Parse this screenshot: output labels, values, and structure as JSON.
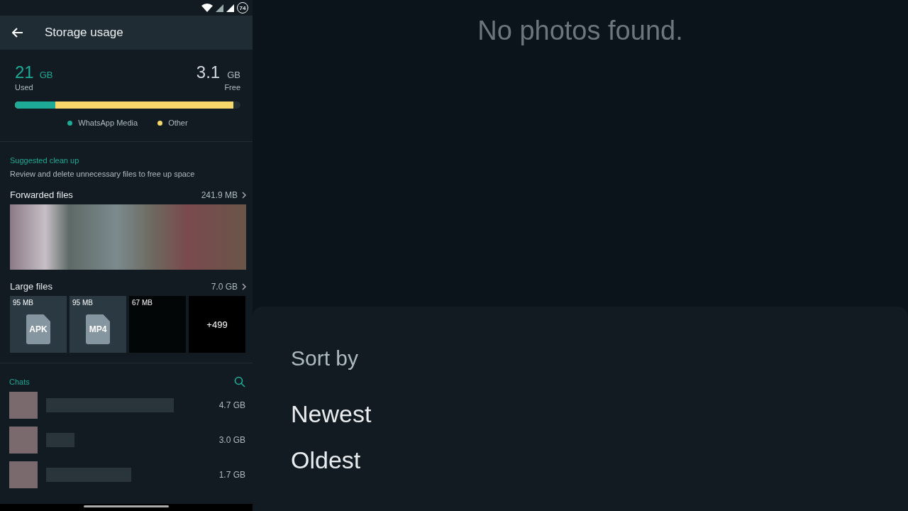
{
  "status_bar": {
    "battery": "74"
  },
  "app_bar": {
    "title": "Storage usage"
  },
  "storage": {
    "used_value": "21",
    "used_unit": "GB",
    "used_label": "Used",
    "free_value": "3.1",
    "free_unit": "GB",
    "free_label": "Free",
    "segments": [
      {
        "name": "WhatsApp Media",
        "color": "#1daa96",
        "level": 0.18
      },
      {
        "name": "Other",
        "color": "#f7d76a",
        "level": 0.97
      }
    ]
  },
  "cleanup": {
    "title": "Suggested clean up",
    "subtitle": "Review and delete unnecessary files to free up space",
    "forwarded": {
      "label": "Forwarded files",
      "size": "241.9 MB"
    },
    "large": {
      "label": "Large files",
      "size": "7.0 GB",
      "tiles": [
        {
          "kind": "file",
          "size": "95 MB",
          "ext": "APK"
        },
        {
          "kind": "file",
          "size": "95 MB",
          "ext": "MP4"
        },
        {
          "kind": "video",
          "size": "67 MB"
        },
        {
          "kind": "more",
          "count": "+499"
        }
      ]
    }
  },
  "chats": {
    "title": "Chats",
    "rows": [
      {
        "size": "4.7 GB"
      },
      {
        "size": "3.0 GB"
      },
      {
        "size": "1.7 GB"
      }
    ]
  },
  "gallery": {
    "empty_message": "No photos found."
  },
  "sort_sheet": {
    "title": "Sort by",
    "options": [
      "Newest",
      "Oldest"
    ]
  }
}
